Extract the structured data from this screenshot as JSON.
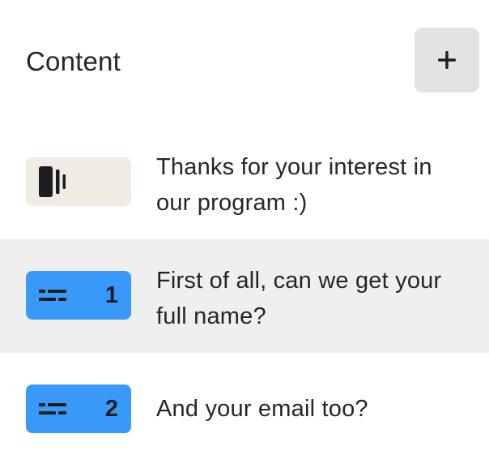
{
  "header": {
    "title": "Content",
    "add_button_icon": "plus-icon"
  },
  "colors": {
    "question_badge": "#3899fb",
    "welcome_badge": "#f0ece4",
    "selected_row": "#efefef",
    "add_button": "#e3e3e3",
    "text": "#262627"
  },
  "items": [
    {
      "type": "welcome-screen",
      "icon": "welcome-screen-icon",
      "number": "",
      "text": "Thanks for your interest in our program :)",
      "selected": false
    },
    {
      "type": "short-text",
      "icon": "short-text-icon",
      "number": "1",
      "text": "First of all, can we get your full name?",
      "selected": true
    },
    {
      "type": "short-text",
      "icon": "short-text-icon",
      "number": "2",
      "text": "And your email too?",
      "selected": false
    }
  ]
}
